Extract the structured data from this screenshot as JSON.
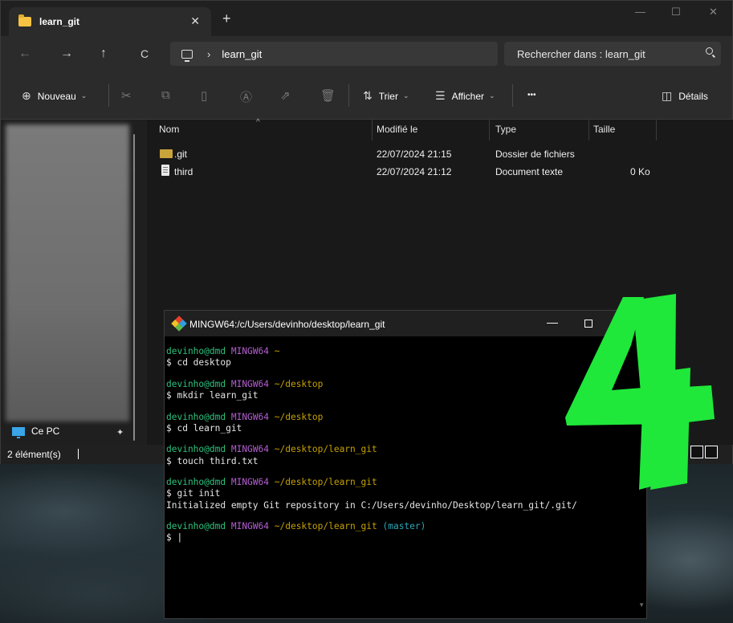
{
  "explorer": {
    "tab_title": "learn_git",
    "tab_close": "✕",
    "new_tab": "+",
    "window_controls": {
      "minimize": "—",
      "maximize": "☐",
      "close": "✕"
    },
    "nav": {
      "back": "←",
      "forward": "→",
      "up": "↑",
      "refresh": "C"
    },
    "address": {
      "separator": "›",
      "path": "learn_git"
    },
    "search": {
      "placeholder": "Rechercher dans : learn_git"
    },
    "toolbar": {
      "new_label": "Nouveau",
      "sort_label": "Trier",
      "view_label": "Afficher",
      "more_label": "•••",
      "details_label": "Détails"
    },
    "columns": {
      "name": "Nom",
      "modified": "Modifié le",
      "type": "Type",
      "size": "Taille"
    },
    "rows": [
      {
        "name": ".git",
        "modified": "22/07/2024 21:15",
        "type": "Dossier de fichiers",
        "size": "",
        "icon": "folder-icon"
      },
      {
        "name": "third",
        "modified": "22/07/2024 21:12",
        "type": "Document texte",
        "size": "0 Ko",
        "icon": "text-file-icon"
      }
    ],
    "sidebar": {
      "this_pc": "Ce PC",
      "pin": "✦"
    },
    "status": {
      "count": "2 élément(s)"
    }
  },
  "terminal": {
    "title": "MINGW64:/c/Users/devinho/desktop/learn_git",
    "min": "—",
    "blocks": [
      {
        "user": "devinho@dmd",
        "host": "MINGW64",
        "path": "~",
        "branch": "",
        "cmd": "$ cd desktop",
        "output": ""
      },
      {
        "user": "devinho@dmd",
        "host": "MINGW64",
        "path": "~/desktop",
        "branch": "",
        "cmd": "$ mkdir learn_git",
        "output": ""
      },
      {
        "user": "devinho@dmd",
        "host": "MINGW64",
        "path": "~/desktop",
        "branch": "",
        "cmd": "$ cd learn_git",
        "output": ""
      },
      {
        "user": "devinho@dmd",
        "host": "MINGW64",
        "path": "~/desktop/learn_git",
        "branch": "",
        "cmd": "$ touch third.txt",
        "output": ""
      },
      {
        "user": "devinho@dmd",
        "host": "MINGW64",
        "path": "~/desktop/learn_git",
        "branch": "",
        "cmd": "$ git init",
        "output": "Initialized empty Git repository in C:/Users/devinho/Desktop/learn_git/.git/"
      },
      {
        "user": "devinho@dmd",
        "host": "MINGW64",
        "path": "~/desktop/learn_git",
        "branch": "(master)",
        "cmd": "$ |",
        "output": ""
      }
    ]
  },
  "overlay": {
    "step_number": "4",
    "color": "#1fe83a"
  },
  "colors": {
    "folder": "#f6c343",
    "accent_pc": "#3aa5e8",
    "prompt_user": "#2ec27e",
    "prompt_host": "#b45fd2",
    "prompt_path": "#c4a000",
    "prompt_branch": "#2aa7b8"
  }
}
